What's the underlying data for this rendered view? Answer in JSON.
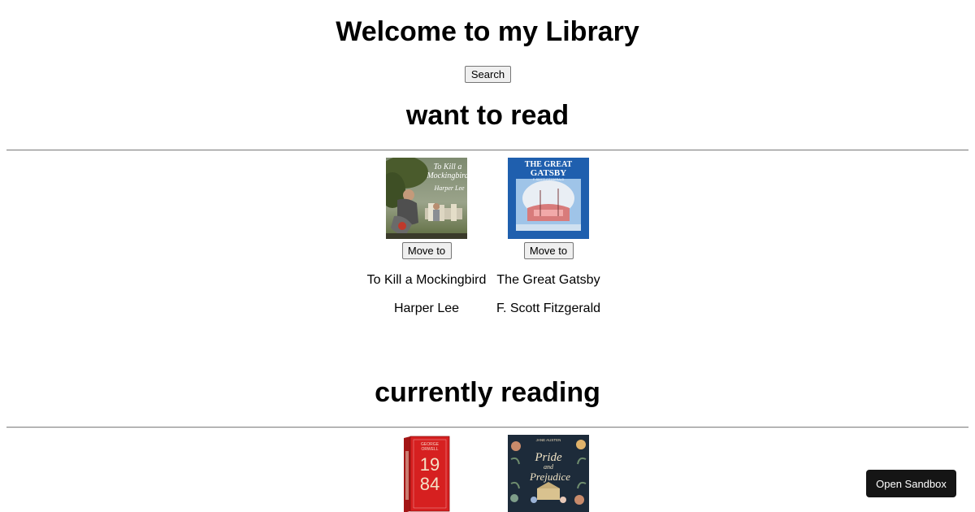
{
  "page": {
    "title": "Welcome to my Library",
    "search_label": "Search",
    "sandbox_label": "Open Sandbox"
  },
  "shelves": [
    {
      "title": "want to read",
      "books": [
        {
          "title": "To Kill a Mockingbird",
          "author": "Harper Lee",
          "move_label": "Move to",
          "cover_text": [
            "To Kill a",
            "Mockingbird",
            "Harper Lee"
          ]
        },
        {
          "title": "The Great Gatsby",
          "author": "F. Scott Fitzgerald",
          "move_label": "Move to",
          "cover_text": [
            "THE GREAT",
            "GATSBY",
            "F. SCOTT FITZGERALD"
          ]
        }
      ]
    },
    {
      "title": "currently reading",
      "books": [
        {
          "cover_text": [
            "GEORGE",
            "ORWELL",
            "19",
            "84"
          ]
        },
        {
          "cover_text": [
            "JANE AUSTEN",
            "Pride",
            "and",
            "Prejudice"
          ]
        }
      ]
    }
  ]
}
